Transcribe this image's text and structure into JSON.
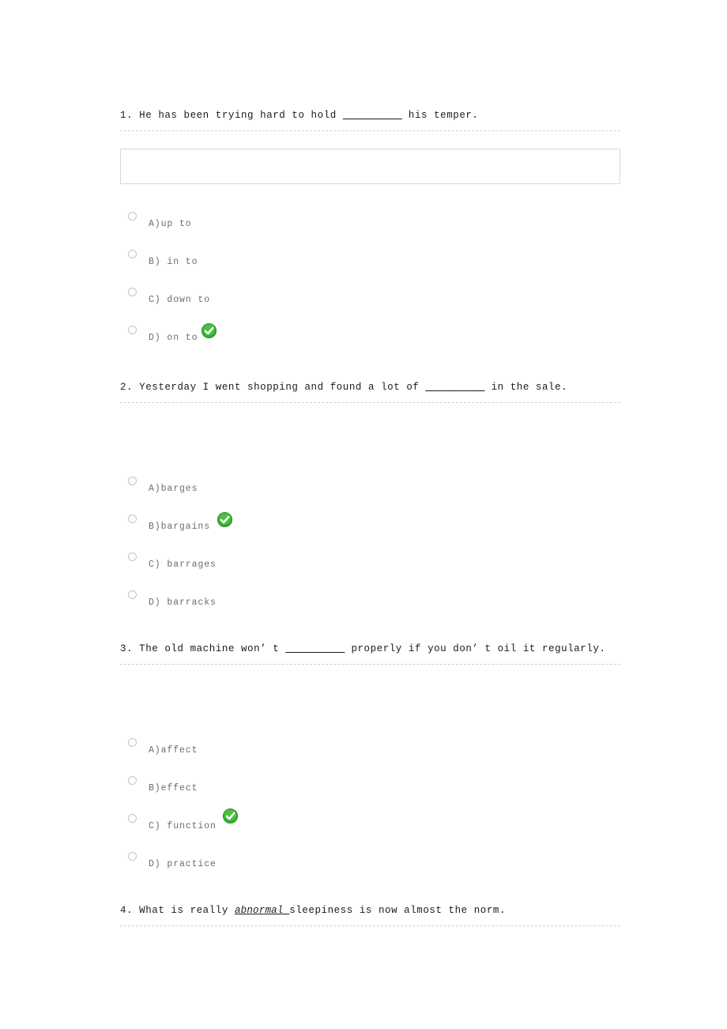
{
  "document": {
    "type": "multiple-choice-quiz",
    "correct_icon_color": "#2fae2f",
    "question_text_color": "#1a1a1a",
    "option_text_color": "#6d6d6d",
    "separator_color": "#cfcfcf"
  },
  "questions": [
    {
      "number": "1.",
      "text": "He has been trying hard to hold",
      "blank": "__________",
      "text_after": "his temper.",
      "has_answer_box": true,
      "answer_box_value": "",
      "options": [
        {
          "label": "A)up to",
          "correct": false
        },
        {
          "label": "B) in to",
          "correct": false
        },
        {
          "label": "C) down to",
          "correct": false
        },
        {
          "label": "D) on to",
          "correct": true
        }
      ]
    },
    {
      "number": "2.",
      "text": "Yesterday I went shopping and found a lot of",
      "blank": "__________",
      "text_after": "in the sale.",
      "has_answer_box": false,
      "answer_box_value": "",
      "options": [
        {
          "label": "A)barges",
          "correct": false
        },
        {
          "label": "B)bargains",
          "correct": true
        },
        {
          "label": "C) barrages",
          "correct": false
        },
        {
          "label": "D) barracks",
          "correct": false
        }
      ]
    },
    {
      "number": "3.",
      "text": "The old machine won’ t",
      "blank": "__________",
      "text_after": "properly if you don’ t oil it regularly.",
      "has_answer_box": false,
      "answer_box_value": "",
      "options": [
        {
          "label": "A)affect",
          "correct": false
        },
        {
          "label": "B)effect",
          "correct": false
        },
        {
          "label": "C) function",
          "correct": true
        },
        {
          "label": "D) practice",
          "correct": false
        }
      ]
    },
    {
      "number": "4.",
      "text_before_emphasis": "What is really",
      "emphasis": "abnormal ",
      "text_after_emphasis": "sleepiness is now almost the norm.",
      "has_answer_box": false,
      "options": []
    }
  ]
}
